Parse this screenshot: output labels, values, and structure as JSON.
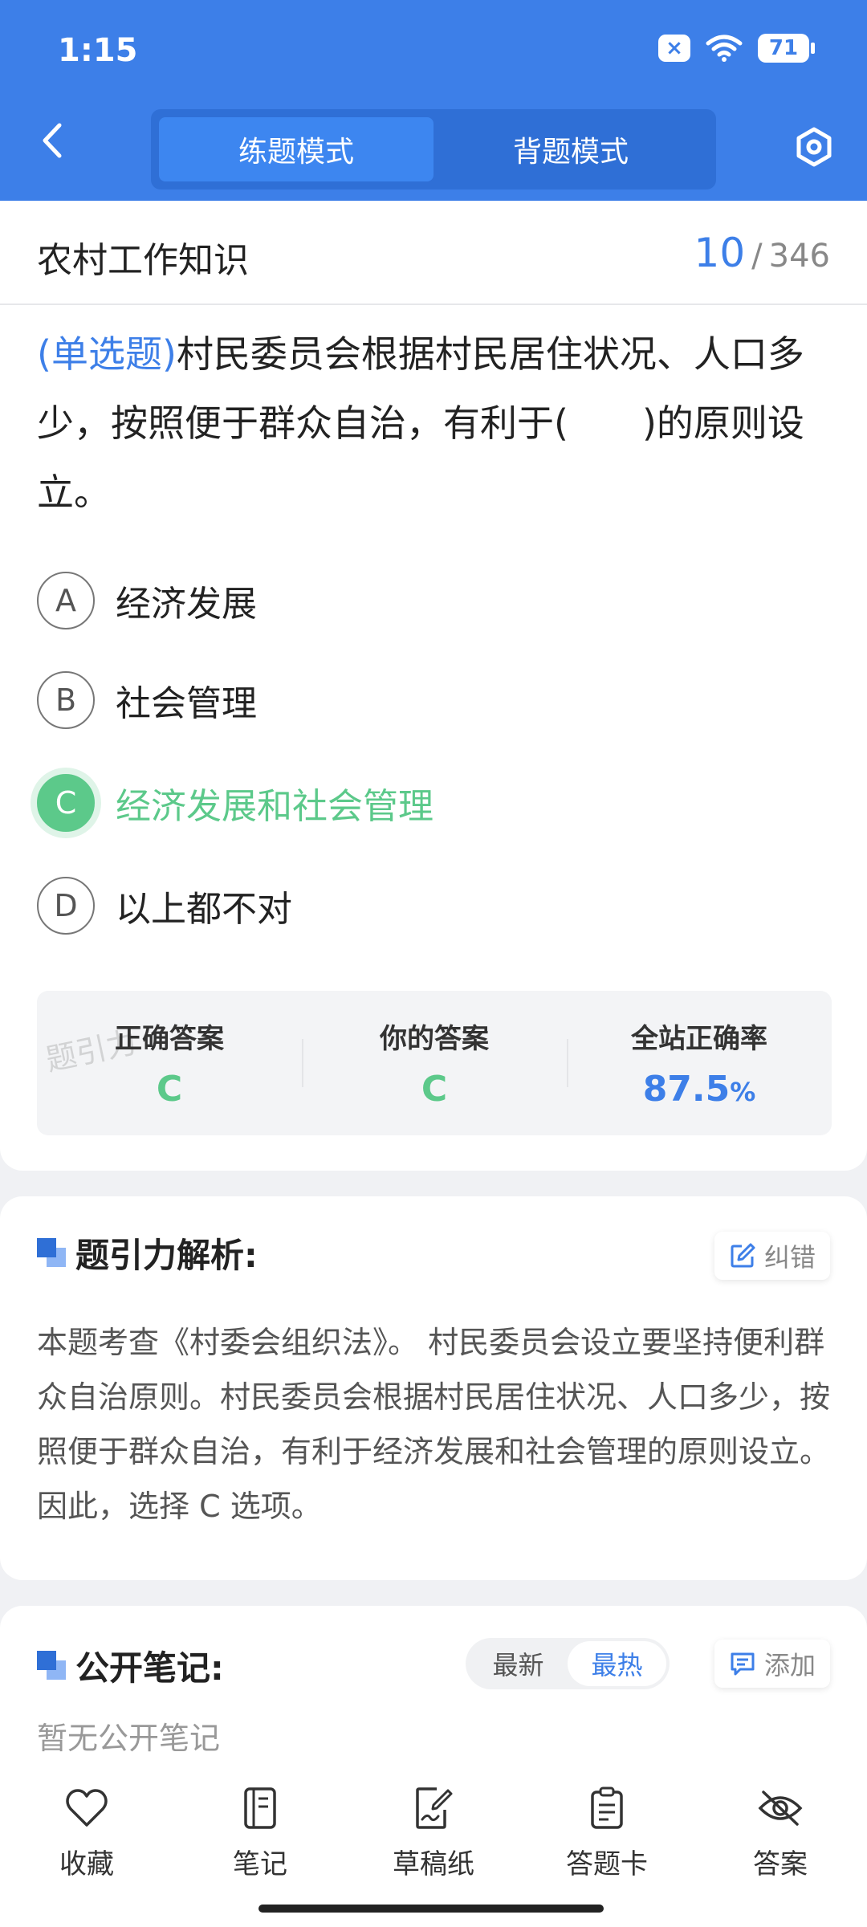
{
  "status_bar": {
    "time": "1:15",
    "battery": "71",
    "icons": [
      "close-box-icon",
      "wifi-icon",
      "battery-icon"
    ]
  },
  "header": {
    "back_icon": "chevron-left-icon",
    "modes": [
      {
        "label": "练题模式",
        "active": true
      },
      {
        "label": "背题模式",
        "active": false
      }
    ],
    "settings_icon": "hexagon-settings-icon"
  },
  "question": {
    "section_title": "农村工作知识",
    "current": "10",
    "separator": "/",
    "total": "346",
    "type_label": "(单选题)",
    "text": "村民委员会根据村民居住状况、人口多少，按照便于群众自治，有利于(　　)的原则设立。",
    "options": [
      {
        "letter": "A",
        "text": "经济发展"
      },
      {
        "letter": "B",
        "text": "社会管理"
      },
      {
        "letter": "C",
        "text": "经济发展和社会管理"
      },
      {
        "letter": "D",
        "text": "以上都不对"
      }
    ]
  },
  "stats": {
    "watermark": "题引力",
    "correct_label": "正确答案",
    "correct_value": "C",
    "your_label": "你的答案",
    "your_value": "C",
    "rate_label": "全站正确率",
    "rate_value": "87.5",
    "rate_unit": "%"
  },
  "analysis": {
    "title": "题引力解析:",
    "report_label": "纠错",
    "text": "本题考查《村委会组织法》。 村民委员会设立要坚持便利群众自治原则。村民委员会根据村民居住状况、人口多少，按照便于群众自治，有利于经济发展和社会管理的原则设立。 因此，选择 C 选项。"
  },
  "notes": {
    "title": "公开笔记:",
    "sort_options": [
      {
        "label": "最新",
        "active": false
      },
      {
        "label": "最热",
        "active": true
      }
    ],
    "add_label": "添加",
    "empty_text": "暂无公开笔记"
  },
  "bottom_bar": [
    {
      "label": "收藏",
      "icon": "heart-icon"
    },
    {
      "label": "笔记",
      "icon": "notebook-icon"
    },
    {
      "label": "草稿纸",
      "icon": "draft-paper-icon"
    },
    {
      "label": "答题卡",
      "icon": "answer-card-icon"
    },
    {
      "label": "答案",
      "icon": "eye-off-icon"
    }
  ],
  "colors": {
    "primary": "#3d7fe8",
    "correct": "#5cc98a"
  }
}
